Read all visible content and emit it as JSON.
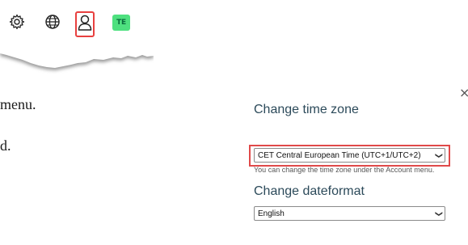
{
  "toolbar": {
    "icons": [
      "gear-icon",
      "globe-icon",
      "user-icon"
    ],
    "brand_badge": "TE",
    "highlight_color": "#e8403f",
    "badge_color": "#4ee07f"
  },
  "doc": {
    "line1": "menu.",
    "line2": "d."
  },
  "panel": {
    "close": "×",
    "timezone": {
      "title": "Change time zone",
      "value": "CET Central European Time (UTC+1/UTC+2)",
      "helper": "You can change the time zone under the Account menu."
    },
    "dateformat": {
      "title": "Change dateformat",
      "value": "English"
    },
    "title_color": "#2c4a5a",
    "frame_color": "#e04a4a"
  }
}
